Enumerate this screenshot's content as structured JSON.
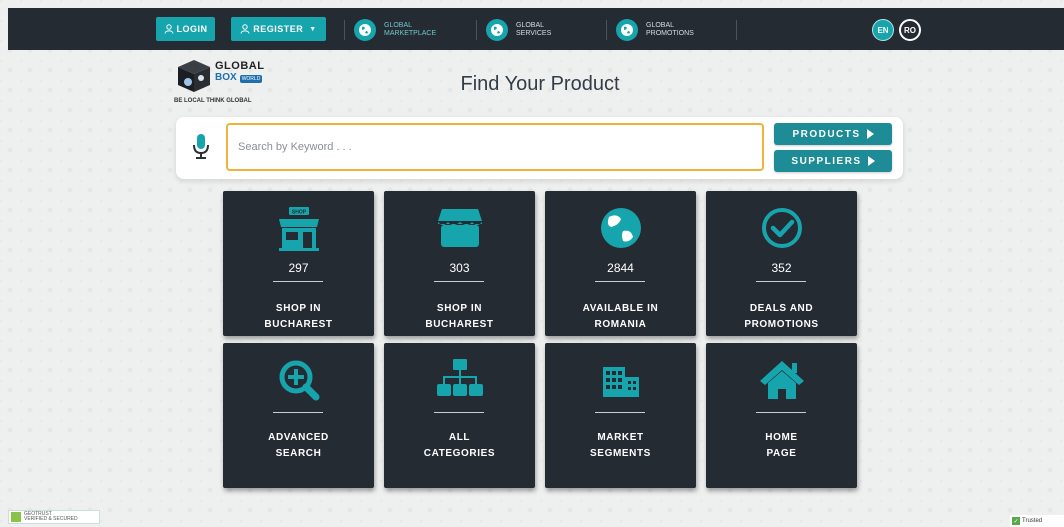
{
  "header": {
    "login_label": "Login",
    "register_label": "Register",
    "nav": [
      {
        "label_line1": "Global",
        "label_line2": "Marketplace",
        "active": true
      },
      {
        "label_line1": "Global",
        "label_line2": "Services",
        "active": false
      },
      {
        "label_line1": "Global",
        "label_line2": "Promotions",
        "active": false
      }
    ],
    "languages": [
      "EN",
      "RO"
    ]
  },
  "logo": {
    "title": "GLOBAL",
    "subtitle": "BOX",
    "world_label": "WORLD",
    "tagline": "BE LOCAL THINK GLOBAL"
  },
  "page_title": "Find Your Product",
  "search": {
    "placeholder": "Search by Keyword . . .",
    "value": "",
    "products_label": "PRODUCTS",
    "suppliers_label": "SUPPLIERS"
  },
  "tiles": [
    {
      "icon": "shop-icon",
      "count": "297",
      "label_line1": "Shop in",
      "label_line2": "Bucharest"
    },
    {
      "icon": "store-icon",
      "count": "303",
      "label_line1": "Shop in",
      "label_line2": "Bucharest"
    },
    {
      "icon": "globe-icon",
      "count": "2844",
      "label_line1": "Available in",
      "label_line2": "Romania"
    },
    {
      "icon": "check-circle-icon",
      "count": "352",
      "label_line1": "Deals and",
      "label_line2": "Promotions"
    },
    {
      "icon": "search-plus-icon",
      "label_line1": "Advanced",
      "label_line2": "Search"
    },
    {
      "icon": "sitemap-icon",
      "label_line1": "All",
      "label_line2": "Categories"
    },
    {
      "icon": "building-icon",
      "label_line1": "Market",
      "label_line2": "Segments"
    },
    {
      "icon": "home-icon",
      "label_line1": "Home",
      "label_line2": "Page"
    }
  ],
  "footer": {
    "left_badge_line1": "GEOTRUST",
    "left_badge_line2": "VERIFIED & SECURED",
    "right_badge": "Trusted"
  },
  "colors": {
    "accent": "#17a5ad",
    "dark": "#252b33",
    "search_border": "#f0b33a"
  }
}
